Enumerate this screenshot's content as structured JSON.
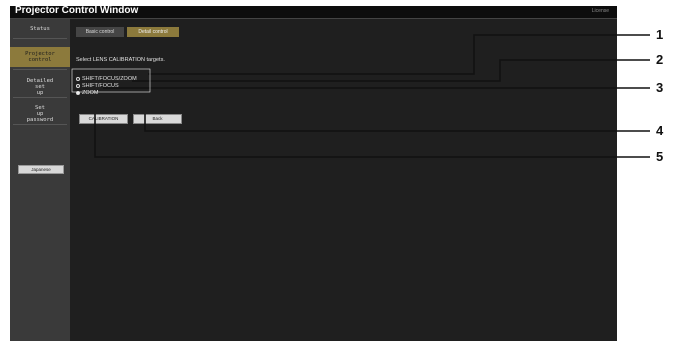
{
  "window": {
    "title": "Projector Control Window",
    "license_link": "License"
  },
  "sidebar": {
    "items": [
      {
        "label": "Status"
      },
      {
        "label": "Projector control"
      },
      {
        "label": "Detailed set up"
      },
      {
        "label": "Set up password"
      }
    ],
    "language_button": "Japanese"
  },
  "tabs": [
    {
      "label": "Basic control"
    },
    {
      "label": "Detail control"
    }
  ],
  "main": {
    "instruction": "Select LENS CALIBRATION targets.",
    "options": [
      {
        "label": "SHIFT/FOCUS/ZOOM",
        "selected": false
      },
      {
        "label": "SHIFT/FOCUS",
        "selected": false
      },
      {
        "label": "ZOOM",
        "selected": true
      }
    ],
    "buttons": {
      "calibration": "CALIBRATION",
      "back": "Back"
    }
  },
  "callouts": [
    "1",
    "2",
    "3",
    "4",
    "5"
  ],
  "colors": {
    "accent": "#8c7a3c",
    "sidebar": "#3a3a3a",
    "main_bg": "#1f1f1f"
  }
}
